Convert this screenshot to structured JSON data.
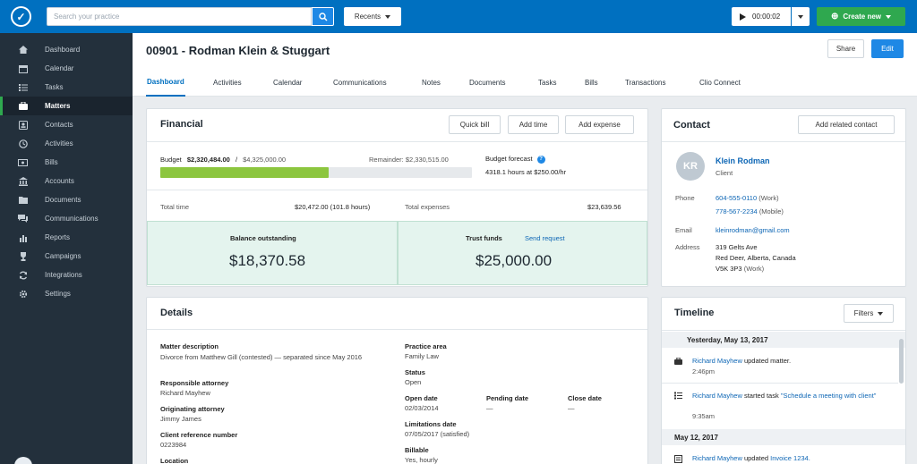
{
  "topbar": {
    "search_placeholder": "Search your practice",
    "recents_label": "Recents",
    "timer_value": "00:00:02",
    "create_label": "Create new"
  },
  "sidebar": {
    "items": [
      {
        "label": "Dashboard",
        "icon": "home-icon"
      },
      {
        "label": "Calendar",
        "icon": "calendar-icon"
      },
      {
        "label": "Tasks",
        "icon": "tasks-icon"
      },
      {
        "label": "Matters",
        "icon": "briefcase-icon",
        "active": true
      },
      {
        "label": "Contacts",
        "icon": "contacts-icon"
      },
      {
        "label": "Activities",
        "icon": "clock-icon"
      },
      {
        "label": "Bills",
        "icon": "bills-icon"
      },
      {
        "label": "Accounts",
        "icon": "bank-icon"
      },
      {
        "label": "Documents",
        "icon": "folder-icon"
      },
      {
        "label": "Communications",
        "icon": "chat-icon"
      },
      {
        "label": "Reports",
        "icon": "chart-icon"
      },
      {
        "label": "Campaigns",
        "icon": "trophy-icon"
      },
      {
        "label": "Integrations",
        "icon": "sync-icon"
      },
      {
        "label": "Settings",
        "icon": "gear-icon"
      }
    ]
  },
  "header": {
    "title": "00901 - Rodman Klein & Stuggart",
    "share_label": "Share",
    "edit_label": "Edit",
    "tabs": [
      "Dashboard",
      "Activities",
      "Calendar",
      "Communications",
      "Notes",
      "Documents",
      "Tasks",
      "Bills",
      "Transactions",
      "Clio Connect"
    ]
  },
  "financial": {
    "title": "Financial",
    "quick_bill": "Quick bill",
    "add_time": "Add time",
    "add_expense": "Add expense",
    "budget_label": "Budget",
    "budget_used": "$2,320,484.00",
    "budget_total": "$4,325,000.00",
    "budget_fraction": 0.54,
    "remainder": "Remainder: $2,330,515.00",
    "forecast_label": "Budget forecast",
    "forecast_value": "4318.1 hours at $250.00/hr",
    "total_time_label": "Total time",
    "total_time_value": "$20,472.00 (101.8 hours)",
    "total_expenses_label": "Total expenses",
    "total_expenses_value": "$23,639.56",
    "balance_label": "Balance outstanding",
    "balance_value": "$18,370.58",
    "trust_label": "Trust funds",
    "send_request": "Send request",
    "trust_value": "$25,000.00"
  },
  "contact": {
    "title": "Contact",
    "add_related": "Add related contact",
    "initials": "KR",
    "name": "Klein Rodman",
    "role": "Client",
    "phone_label": "Phone",
    "phone1": "604-555-0110",
    "phone1_type": "(Work)",
    "phone2": "778-567-2234",
    "phone2_type": "(Mobile)",
    "email_label": "Email",
    "email": "kleinrodman@gmail.com",
    "address_label": "Address",
    "address1": "319 Gelts Ave",
    "address2": "Red Deer, Alberta, Canada",
    "address3": "V5K 3P3",
    "address_type": "(Work)"
  },
  "details": {
    "title": "Details",
    "matter_desc_label": "Matter description",
    "matter_desc": "Divorce from Matthew Gill (contested) — separated since May 2016",
    "resp_attorney_label": "Responsible attorney",
    "resp_attorney": "Richard Mayhew",
    "orig_attorney_label": "Originating attorney",
    "orig_attorney": "Jimmy James",
    "client_ref_label": "Client reference number",
    "client_ref": "0223984",
    "location_label": "Location",
    "practice_area_label": "Practice area",
    "practice_area": "Family Law",
    "status_label": "Status",
    "status": "Open",
    "open_date_label": "Open date",
    "open_date": "02/03/2014",
    "pending_date_label": "Pending date",
    "pending_date": "—",
    "close_date_label": "Close date",
    "close_date": "—",
    "limitations_label": "Limitations date",
    "limitations": "07/05/2017 (satisfied)",
    "billable_label": "Billable",
    "billable": "Yes, hourly"
  },
  "timeline": {
    "title": "Timeline",
    "filters_label": "Filters",
    "date1": "Yesterday, May 13, 2017",
    "entry1_user": "Richard Mayhew",
    "entry1_action": "updated matter.",
    "entry1_time": "2:46pm",
    "entry2_user": "Richard Mayhew",
    "entry2_action": "started task",
    "entry2_task": "\"Schedule a meeting with client\"",
    "entry2_time": "9:35am",
    "date2": "May 12, 2017",
    "entry3_user": "Richard Mayhew",
    "entry3_action": "updated",
    "entry3_target": "Invoice 1234."
  }
}
